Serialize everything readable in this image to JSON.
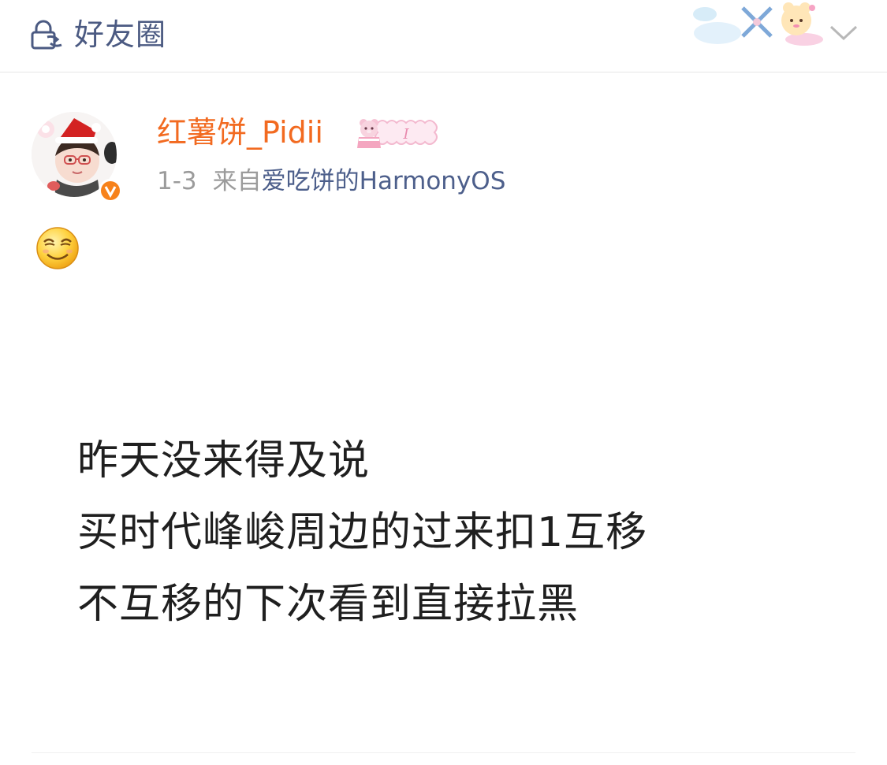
{
  "header": {
    "title": "好友圈",
    "icons": {
      "visibility": "friends-lock-icon",
      "menu": "chevron-down-icon"
    }
  },
  "post": {
    "author": {
      "name": "红薯饼_Pidii",
      "verified": true,
      "avatar_icon": "avatar-santa-hat",
      "badge_icon": "bear-badge-icon"
    },
    "date": "1-3",
    "source_prefix": "来自",
    "source_device": "爱吃饼的HarmonyOS",
    "emoji": "smile-emoji",
    "lines": [
      "昨天没来得及说",
      "买时代峰峻周边的过来扣1互移",
      "不互移的下次看到直接拉黑"
    ]
  },
  "colors": {
    "username": "#f26a20",
    "source_device": "#4d5f8b",
    "header_title": "#4b5a82",
    "meta_gray": "#9b9b9b",
    "verified_badge": "#f7821b"
  }
}
